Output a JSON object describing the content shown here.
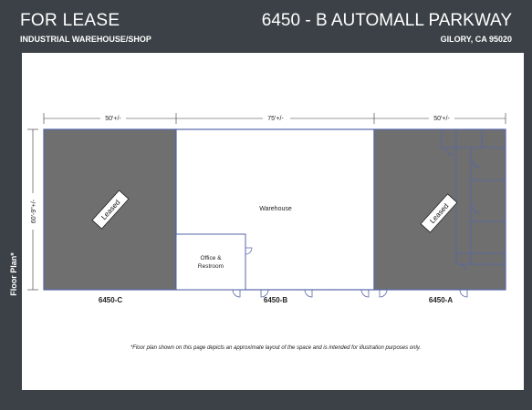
{
  "header": {
    "left_title": "FOR LEASE",
    "left_subtitle": "INDUSTRIAL WAREHOUSE/SHOP",
    "right_title": "6450 - B AUTOMALL PARKWAY",
    "right_subtitle": "GILORY, CA 95020"
  },
  "side_label": "Floor Plan*",
  "plan": {
    "dim_left": "50'+/-",
    "dim_mid": "75'+/-",
    "dim_right": "50'+/-",
    "dim_height": "60'-9\"+/-",
    "unit_c": "6450-C",
    "unit_b": "6450-B",
    "unit_a": "6450-A",
    "warehouse": "Warehouse",
    "office_line1": "Office &",
    "office_line2": "Restroom",
    "leased_c": "Leased",
    "leased_a": "Leased"
  },
  "footnote": "*Floor plan shown on this page depicts an approximate layout of the space and is intended for illustration purposes only.",
  "colors": {
    "frame": "#3b4146",
    "leased_fill": "#6f6f6f",
    "wall": "#5566aa"
  }
}
